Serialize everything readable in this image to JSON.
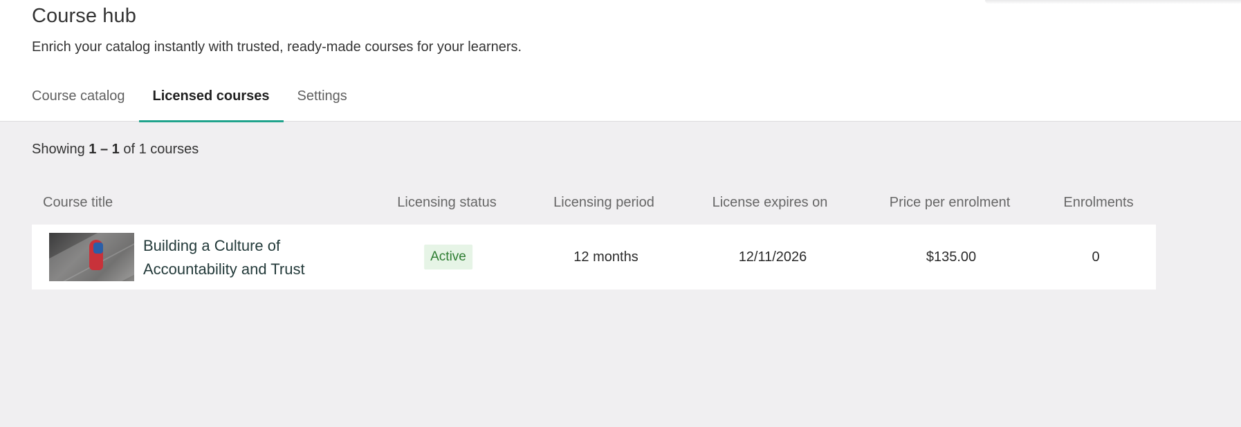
{
  "header": {
    "title": "Course hub",
    "subtitle": "Enrich your catalog instantly with trusted, ready-made courses for your learners."
  },
  "tabs": [
    {
      "label": "Course catalog",
      "active": false
    },
    {
      "label": "Licensed courses",
      "active": true
    },
    {
      "label": "Settings",
      "active": false
    }
  ],
  "results": {
    "prefix": "Showing",
    "range": "1 – 1",
    "suffix": "of 1 courses"
  },
  "table": {
    "columns": {
      "title": "Course title",
      "status": "Licensing status",
      "period": "Licensing period",
      "expires": "License expires on",
      "price": "Price per enrolment",
      "enrolments": "Enrolments"
    },
    "rows": [
      {
        "title": "Building a Culture of Accountability and Trust",
        "status": "Active",
        "period": "12 months",
        "expires": "12/11/2026",
        "price": "$135.00",
        "enrolments": "0"
      }
    ]
  },
  "colors": {
    "accent": "#1fa38c",
    "status_active_bg": "#e6f4e6",
    "status_active_text": "#2e7d32",
    "page_bg": "#f0eff1"
  }
}
